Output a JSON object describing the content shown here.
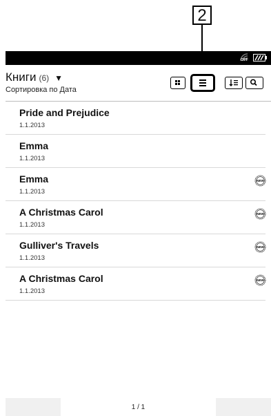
{
  "callout": {
    "number": "2"
  },
  "statusbar": {
    "wifi_state": "OFF"
  },
  "header": {
    "title": "Книги",
    "count": "(6)",
    "dropdown_glyph": "▼",
    "sort_label": "Сортировка по Дата"
  },
  "toolbar": {
    "icons": [
      "grid-view-icon",
      "list-view-icon",
      "sort-icon",
      "search-icon"
    ],
    "active": "list-view-icon"
  },
  "books": [
    {
      "title": "Pride and Prejudice",
      "date": "1.1.2013",
      "new": false
    },
    {
      "title": "Emma",
      "date": "1.1.2013",
      "new": false
    },
    {
      "title": "Emma",
      "date": "1.1.2013",
      "new": true
    },
    {
      "title": "A Christmas Carol",
      "date": "1.1.2013",
      "new": true
    },
    {
      "title": "Gulliver's Travels",
      "date": "1.1.2013",
      "new": true
    },
    {
      "title": "A Christmas Carol",
      "date": "1.1.2013",
      "new": true
    }
  ],
  "badge": {
    "text": "NEW"
  },
  "footer": {
    "page": "1 / 1"
  }
}
